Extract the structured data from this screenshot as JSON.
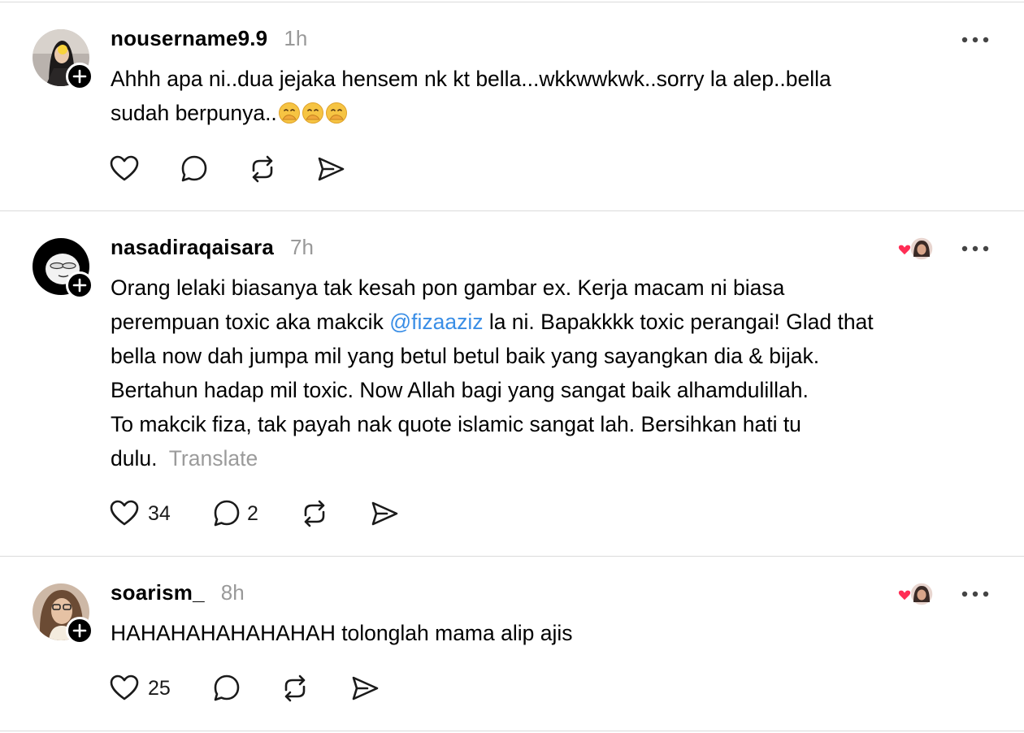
{
  "posts": [
    {
      "username": "nousername9.9",
      "time": "1h",
      "text_lines": [
        "Ahhh apa ni..dua jejaka hensem nk kt bella...wkkwwkwk..sorry la alep..bella",
        "sudah berpunya.."
      ],
      "emoji": [
        "🤭",
        "🤭",
        "🤭"
      ],
      "likes": "",
      "replies": ""
    },
    {
      "username": "nasadiraqaisara",
      "time": "7h",
      "text_line1": "Orang lelaki biasanya tak kesah pon gambar ex. Kerja macam ni biasa",
      "text_line2_before": "perempuan toxic aka makcik ",
      "mention": "@fizaaziz",
      "text_line2_after": " la ni. Bapakkkk toxic perangai! Glad that",
      "text_line3": "bella now dah jumpa mil yang betul betul baik yang sayangkan dia & bijak.",
      "text_line4": "Bertahun hadap mil toxic. Now Allah bagi yang sangat baik alhamdulillah.",
      "text_line5": "To makcik fiza, tak payah nak quote islamic sangat lah. Bersihkan hati tu",
      "text_line6": "dulu.",
      "translate_label": "Translate",
      "likes": "34",
      "replies": "2"
    },
    {
      "username": "soarism_",
      "time": "8h",
      "text": "HAHAHAHAHAHAHAH tolonglah mama alip ajis",
      "likes": "25",
      "replies": ""
    }
  ],
  "icons": {
    "like": "heart-icon",
    "reply": "comment-bubble-icon",
    "repost": "repost-icon",
    "share": "send-icon",
    "more": "more-horizontal-icon",
    "follow": "plus-icon",
    "liked_by_author": "heart-badge-icon"
  },
  "colors": {
    "mention": "#3a8ee6",
    "timestamp": "#999999",
    "divider": "#dbdbdb",
    "heart_badge": "#ff2d55"
  }
}
